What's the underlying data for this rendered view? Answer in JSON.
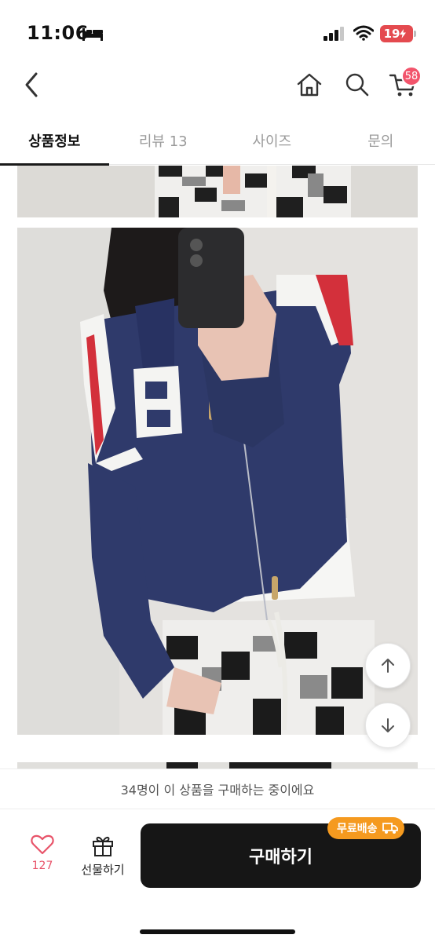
{
  "status_bar": {
    "time": "11:06",
    "battery": "19",
    "icons": [
      "bed-icon",
      "signal-icon",
      "wifi-icon",
      "battery-icon"
    ]
  },
  "nav": {
    "icons": [
      "back-arrow-icon",
      "home-icon",
      "search-icon",
      "cart-icon"
    ],
    "cart_badge": "58"
  },
  "tabs": [
    {
      "label": "상품정보",
      "active": true
    },
    {
      "label": "리뷰 13",
      "active": false
    },
    {
      "label": "사이즈",
      "active": false
    },
    {
      "label": "문의",
      "active": false
    }
  ],
  "content": {
    "images": [
      "product-photo-pants",
      "product-photo-navy-zip-hoodie",
      "product-photo-next"
    ],
    "scroll_icons": [
      "arrow-up-icon",
      "arrow-down-icon"
    ]
  },
  "notice": "34명이 이 상품을 구매하는 중이에요",
  "action_bar": {
    "like_count": "127",
    "gift_label": "선물하기",
    "buy_label": "구매하기",
    "free_shipping": "무료배송"
  },
  "colors": {
    "accent_red": "#e8546a",
    "badge_orange": "#f59a1f",
    "buy_button": "#161616",
    "hoodie_navy": "#2f3a6b"
  }
}
